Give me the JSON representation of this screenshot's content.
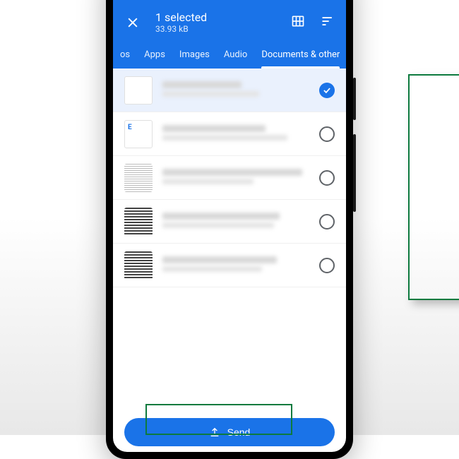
{
  "header": {
    "title": "1 selected",
    "subtitle": "33.93 kB"
  },
  "tabs": {
    "partial": "os",
    "items": [
      "Apps",
      "Images",
      "Audio",
      "Documents & other"
    ],
    "activeIndex": 3
  },
  "files": [
    {
      "selected": true,
      "thumbType": "doc",
      "titleWidth": "54%",
      "subWidth": "66%"
    },
    {
      "selected": false,
      "thumbType": "letter",
      "titleWidth": "70%",
      "subWidth": "85%"
    },
    {
      "selected": false,
      "thumbType": "sheet",
      "titleWidth": "95%",
      "subWidth": "62%"
    },
    {
      "selected": false,
      "thumbType": "stripes",
      "titleWidth": "80%",
      "subWidth": "76%"
    },
    {
      "selected": false,
      "thumbType": "stripes",
      "titleWidth": "78%",
      "subWidth": "68%"
    }
  ],
  "action": {
    "sendLabel": "Send"
  },
  "colors": {
    "primary": "#1a73e8",
    "highlight": "#0d7a3e"
  }
}
